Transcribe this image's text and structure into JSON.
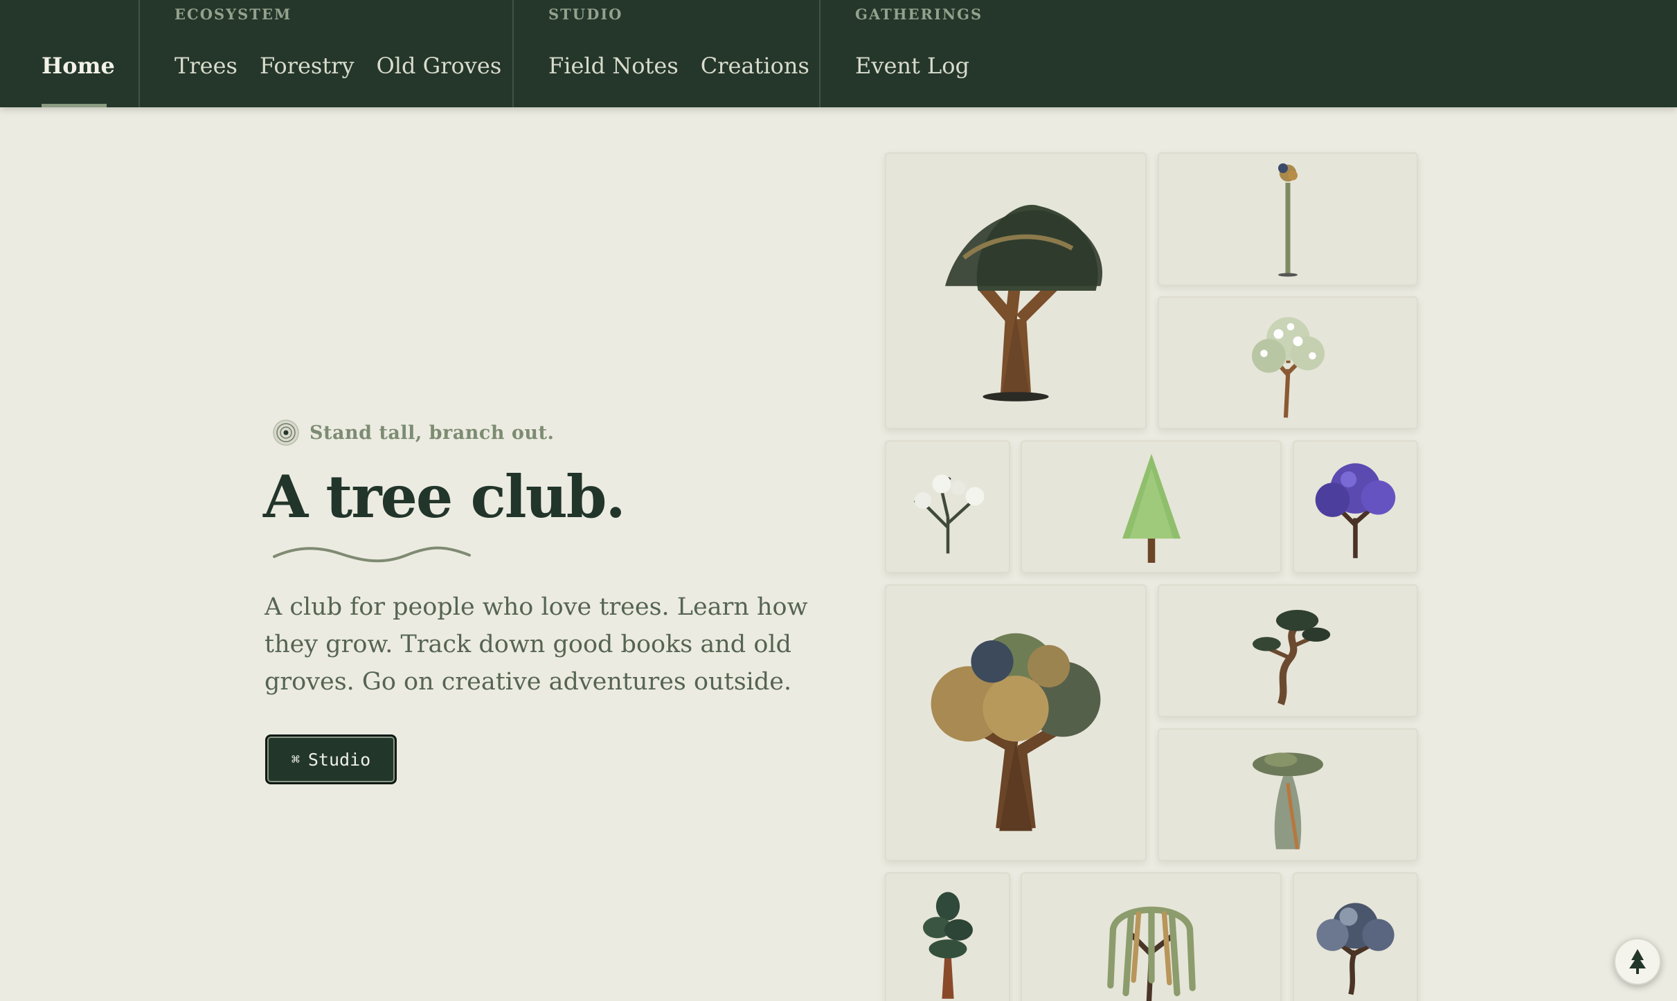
{
  "nav": {
    "home": "Home",
    "groups": [
      {
        "caption": "ECOSYSTEM",
        "links": [
          "Trees",
          "Forestry",
          "Old Groves"
        ]
      },
      {
        "caption": "STUDIO",
        "links": [
          "Field Notes",
          "Creations"
        ]
      },
      {
        "caption": "GATHERINGS",
        "links": [
          "Event Log"
        ]
      }
    ]
  },
  "hero": {
    "eyebrow": "Stand tall, branch out.",
    "title": "A tree club.",
    "description": "A club for people who love trees. Learn how they grow. Track down good books and old groves. Go on creative adventures outside.",
    "button_key": "⌘",
    "button_label": "Studio"
  },
  "gallery": [
    "dragon-tree-icon",
    "tall-thin-tree-icon",
    "white-blossom-tree-icon",
    "bare-white-tree-icon",
    "green-conifer-icon",
    "purple-jacaranda-icon",
    "oak-tree-icon",
    "gnarled-pine-icon",
    "baobab-tree-icon",
    "redwood-tree-icon",
    "willow-tree-icon",
    "olive-tree-icon"
  ],
  "colors": {
    "nav_bg": "#25372b",
    "page_bg": "#ecebe1",
    "accent": "#7c8c72"
  }
}
